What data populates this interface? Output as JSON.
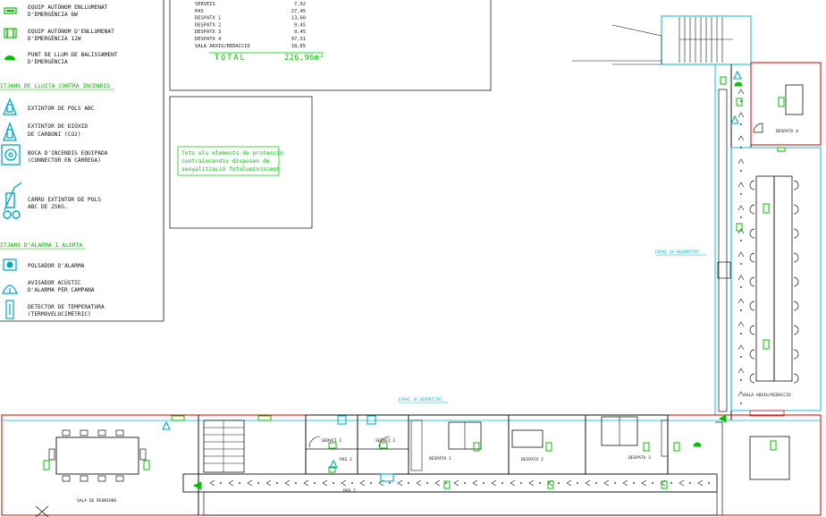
{
  "legend": {
    "lighting": [
      {
        "icon": "emergency-light-6w-icon",
        "lines": [
          "EQUIP AUTÒNOM ENLLUMENAT",
          "D'EMERGÈNCIA 6W"
        ]
      },
      {
        "icon": "emergency-light-12w-icon",
        "lines": [
          "EQUIP AUTÒNOM D'ENLLUMENAT",
          "D'EMERGÈNCIA 12W"
        ]
      },
      {
        "icon": "low-light-point-icon",
        "lines": [
          "PUNT DE LLUM DE BALISSAMENT",
          "D'EMERGÈNCIA"
        ]
      }
    ],
    "fire_heading": "ITJANS DE LLUITA CONTRA INCENDIS",
    "fire": [
      {
        "icon": "abc-powder-extinguisher-icon",
        "lines": [
          "EXTINTOR DE POLS ABC"
        ]
      },
      {
        "icon": "co2-extinguisher-icon",
        "lines": [
          "EXTINTOR DE DIÒXID",
          "DE CARBONI (CO2)"
        ]
      },
      {
        "icon": "fire-hose-reel-icon",
        "lines": [
          "BOCA D'INCENDIS EQUIPADA",
          "(CONNECTOR EN CÀRREGA)"
        ]
      },
      {
        "icon": "wheeled-extinguisher-icon",
        "lines": [
          "CARRO EXTINTOR DE POLS",
          "ABC DE 25KG."
        ]
      }
    ],
    "alarm_heading": "ITJANS D'ALARMA I ALERTA",
    "alarm": [
      {
        "icon": "alarm-pushbutton-icon",
        "lines": [
          "POLSADOR D'ALARMA"
        ]
      },
      {
        "icon": "alarm-bell-icon",
        "lines": [
          "AVISADOR ACÚSTIC",
          "D'ALARMA PER CAMPANA"
        ]
      },
      {
        "icon": "temperature-detector-icon",
        "lines": [
          "DETECTOR DE TEMPERATURA",
          "(TERMOVELOCIMÈTRIC)"
        ]
      }
    ]
  },
  "areas_table": {
    "rows": [
      {
        "name": "SERVEIS",
        "value": "7,92"
      },
      {
        "name": "PAS",
        "value": "27,45"
      },
      {
        "name": "DESPATX 1",
        "value": "13,60"
      },
      {
        "name": "DESPATX 2",
        "value": "9,45"
      },
      {
        "name": "DESPATX 3",
        "value": "9,45"
      },
      {
        "name": "DESPATX 4",
        "value": "97,51"
      },
      {
        "name": "SALA ARXIU/REDACCIÓ",
        "value": "18,85"
      }
    ],
    "total_label": "TOTAL",
    "total_value": "226,96m²"
  },
  "note": [
    "Tots els elements de protecció",
    "contraincendis disposen de",
    "senyalització fotoluminiscent"
  ],
  "rooms": {
    "despatx4": "DESPATX 4",
    "sala_arxiu": "SALA ARXIU/REDACCIÓ",
    "sala_reunions": "SALA DE REUNIONS",
    "serv1": "SERVEI 1",
    "serv2": "SERVEI 2",
    "pas1": "PAS 1",
    "pas2": "PAS 2",
    "despatx1": "DESPATX 1",
    "despatx2": "DESPATX 2",
    "despatx3": "DESPATX 3"
  },
  "evac_note": "ESPAI JA SEGURITZAT",
  "colors": {
    "wall": "#111111",
    "accent": "#00c000",
    "section": "#00b8d0",
    "fire": "#cc0000"
  }
}
